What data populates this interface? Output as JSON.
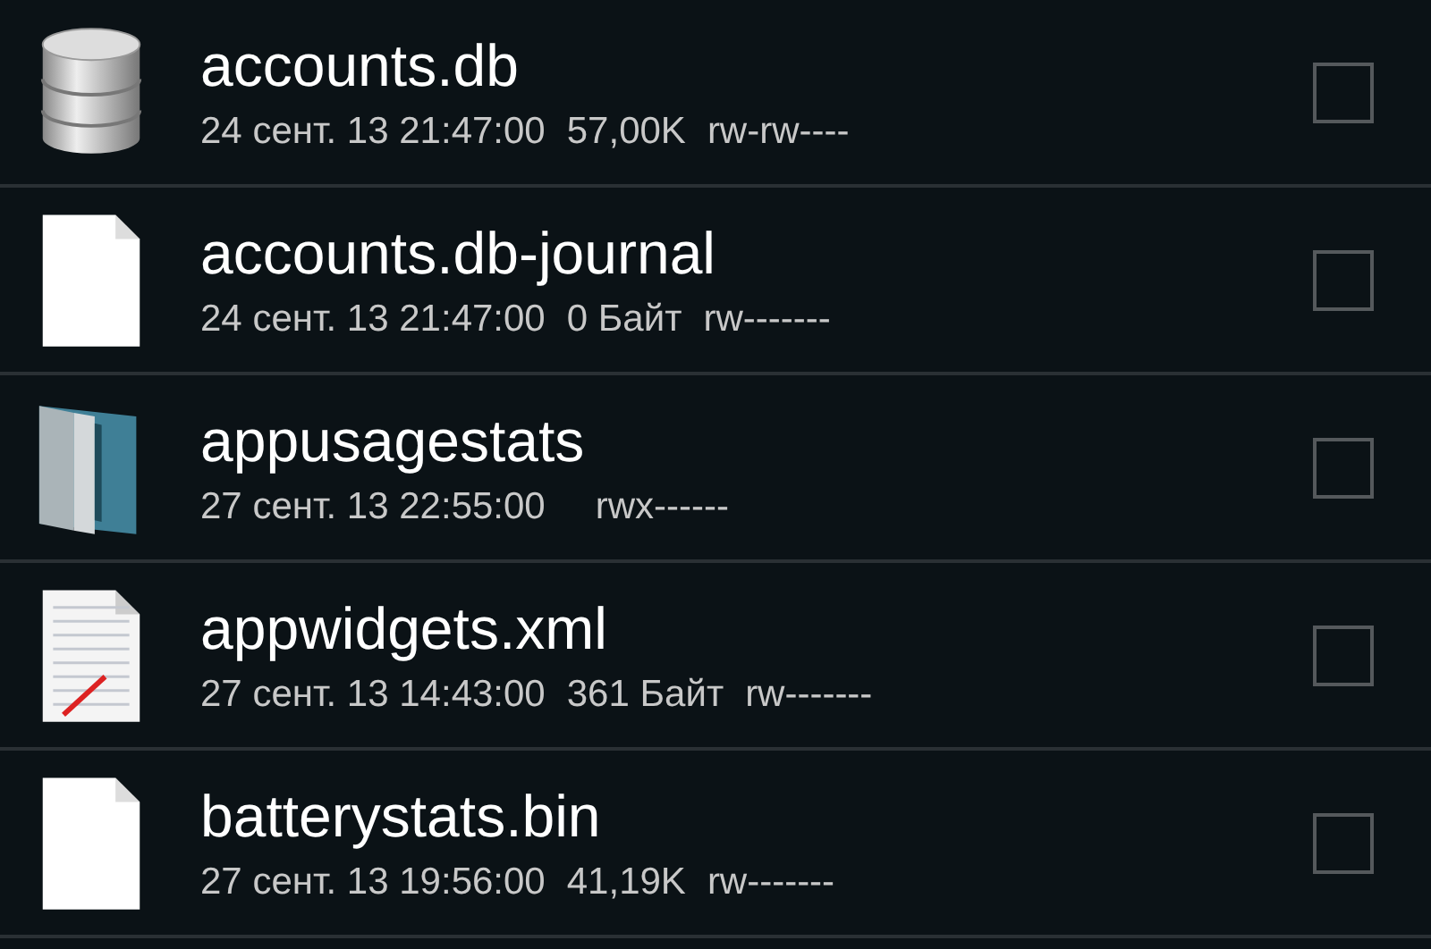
{
  "files": [
    {
      "kind": "database",
      "name": "accounts.db",
      "date": "24 сент. 13 21:47:00",
      "size": "57,00K",
      "permissions": "rw-rw----",
      "checked": false
    },
    {
      "kind": "file",
      "name": "accounts.db-journal",
      "date": "24 сент. 13 21:47:00",
      "size": "0 Байт",
      "permissions": "rw-------",
      "checked": false
    },
    {
      "kind": "folder",
      "name": "appusagestats",
      "date": "27 сент. 13 22:55:00",
      "permissions": "rwx------",
      "checked": false
    },
    {
      "kind": "text",
      "name": "appwidgets.xml",
      "date": "27 сент. 13 14:43:00",
      "size": "361 Байт",
      "permissions": "rw-------",
      "checked": false
    },
    {
      "kind": "file",
      "name": "batterystats.bin",
      "date": "27 сент. 13 19:56:00",
      "size": "41,19K",
      "permissions": "rw-------",
      "checked": false
    }
  ]
}
